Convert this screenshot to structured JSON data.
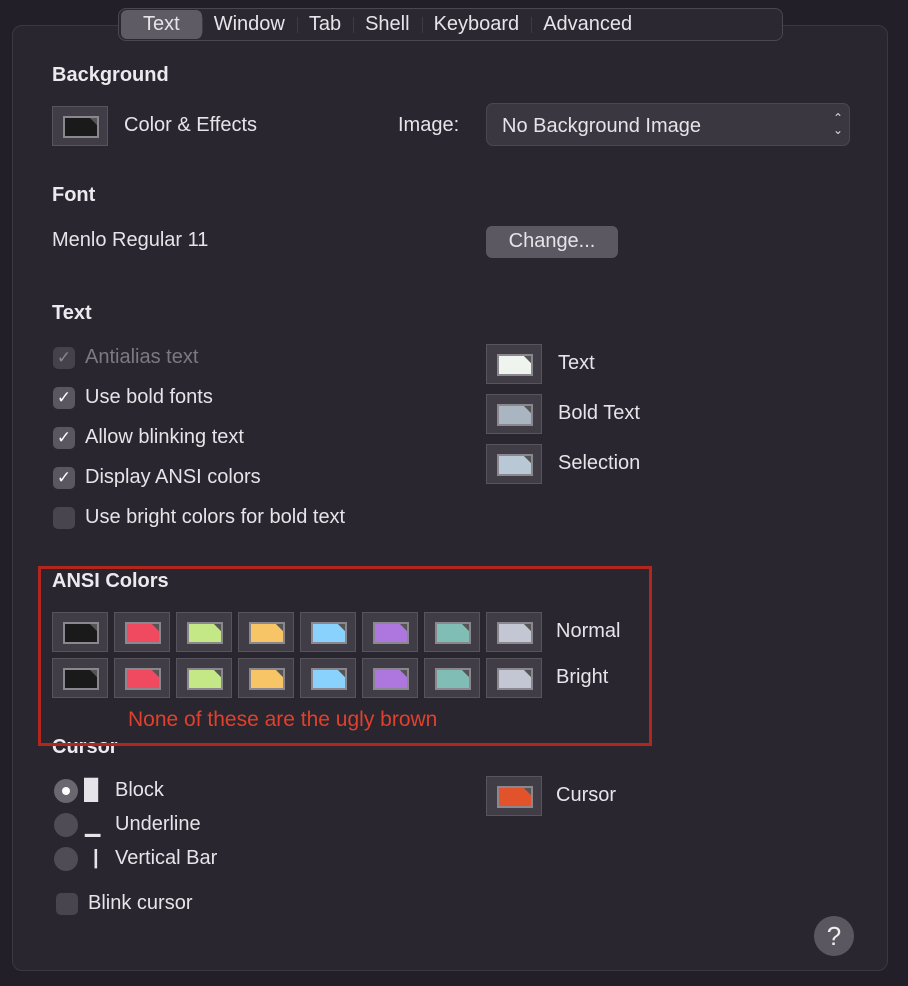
{
  "tabs": [
    {
      "label": "Text",
      "selected": true
    },
    {
      "label": "Window"
    },
    {
      "label": "Tab"
    },
    {
      "label": "Shell"
    },
    {
      "label": "Keyboard"
    },
    {
      "label": "Advanced"
    }
  ],
  "background": {
    "heading": "Background",
    "color_label": "Color & Effects",
    "color": "#1a1a1a",
    "image_label": "Image:",
    "image_value": "No Background Image"
  },
  "font": {
    "heading": "Font",
    "value": "Menlo Regular 11",
    "change_label": "Change..."
  },
  "text": {
    "heading": "Text",
    "options": [
      {
        "label": "Antialias text",
        "checked": true,
        "disabled": true
      },
      {
        "label": "Use bold fonts",
        "checked": true
      },
      {
        "label": "Allow blinking text",
        "checked": true
      },
      {
        "label": "Display ANSI colors",
        "checked": true
      },
      {
        "label": "Use bright colors for bold text",
        "checked": false
      }
    ],
    "colors": [
      {
        "label": "Text",
        "color": "#eff4ef"
      },
      {
        "label": "Bold Text",
        "color": "#a9b6c1"
      },
      {
        "label": "Selection",
        "color": "#b8c9d5"
      }
    ]
  },
  "ansi": {
    "heading": "ANSI Colors",
    "normal_label": "Normal",
    "bright_label": "Bright",
    "normal": [
      "#1a1a1a",
      "#ef4a60",
      "#c3e885",
      "#f7c566",
      "#89d2fd",
      "#ad77df",
      "#80beb5",
      "#c3c7d3"
    ],
    "bright": [
      "#1a1a1a",
      "#ef4a60",
      "#c3e885",
      "#f7c566",
      "#89d2fd",
      "#ad77df",
      "#80beb5",
      "#c3c7d3"
    ]
  },
  "annotation": {
    "text": "None of these are the ugly brown",
    "color": "#b3261e"
  },
  "cursor": {
    "heading": "Cursor",
    "options": [
      {
        "label": "Block",
        "glyph": "█",
        "selected": true
      },
      {
        "label": "Underline",
        "glyph": "▁"
      },
      {
        "label": "Vertical Bar",
        "glyph": "|"
      }
    ],
    "blink_label": "Blink cursor",
    "blink_checked": false,
    "color_label": "Cursor",
    "color": "#e2532b"
  },
  "help": {
    "label": "?"
  }
}
